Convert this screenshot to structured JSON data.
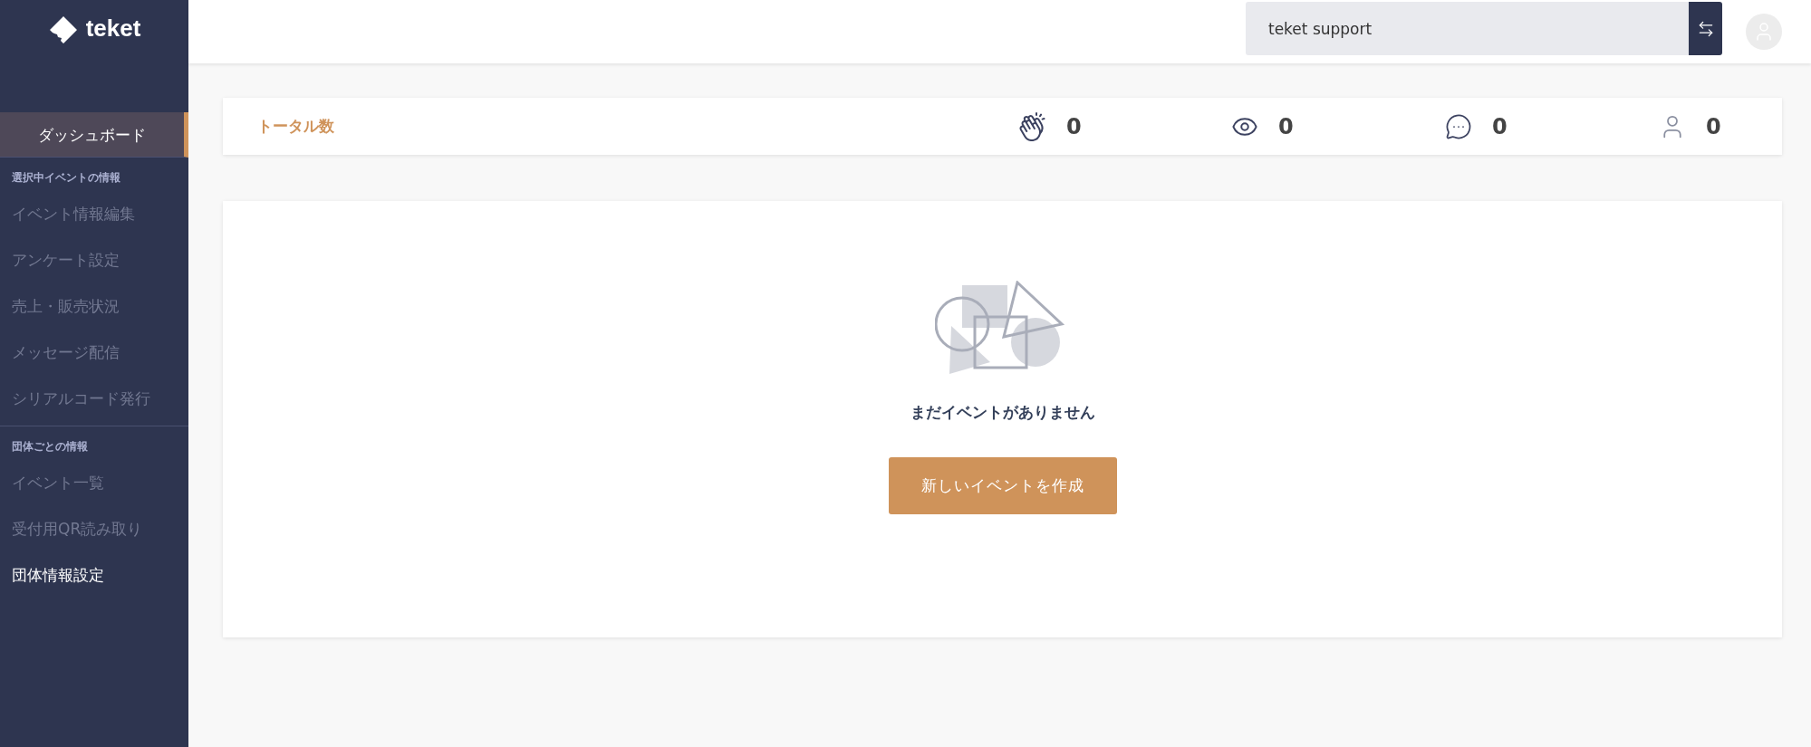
{
  "logo": {
    "text": "teket"
  },
  "header": {
    "account_field": {
      "value": "teket support"
    }
  },
  "sidebar": {
    "dashboard": {
      "label": "ダッシュボード",
      "selected": true
    },
    "sections": [
      {
        "heading": "選択中イベントの情報",
        "items": [
          {
            "label": "イベント情報編集",
            "selected": false
          },
          {
            "label": "アンケート設定",
            "selected": false
          },
          {
            "label": "売上・販売状況",
            "selected": false
          },
          {
            "label": "メッセージ配信",
            "selected": false
          },
          {
            "label": "シリアルコード発行",
            "selected": false
          }
        ]
      },
      {
        "heading": "団体ごとの情報",
        "items": [
          {
            "label": "イベント一覧",
            "selected": false
          },
          {
            "label": "受付用QR読み取り",
            "selected": false
          },
          {
            "label": "団体情報設定",
            "selected": true
          }
        ]
      }
    ]
  },
  "totals": {
    "label": "トータル数",
    "stats": [
      {
        "kind": "claps",
        "value": "0"
      },
      {
        "kind": "views",
        "value": "0"
      },
      {
        "kind": "comments",
        "value": "0"
      },
      {
        "kind": "users",
        "value": "0"
      }
    ]
  },
  "empty_state": {
    "message": "まだイベントがありません",
    "button": "新しいイベントを作成"
  }
}
